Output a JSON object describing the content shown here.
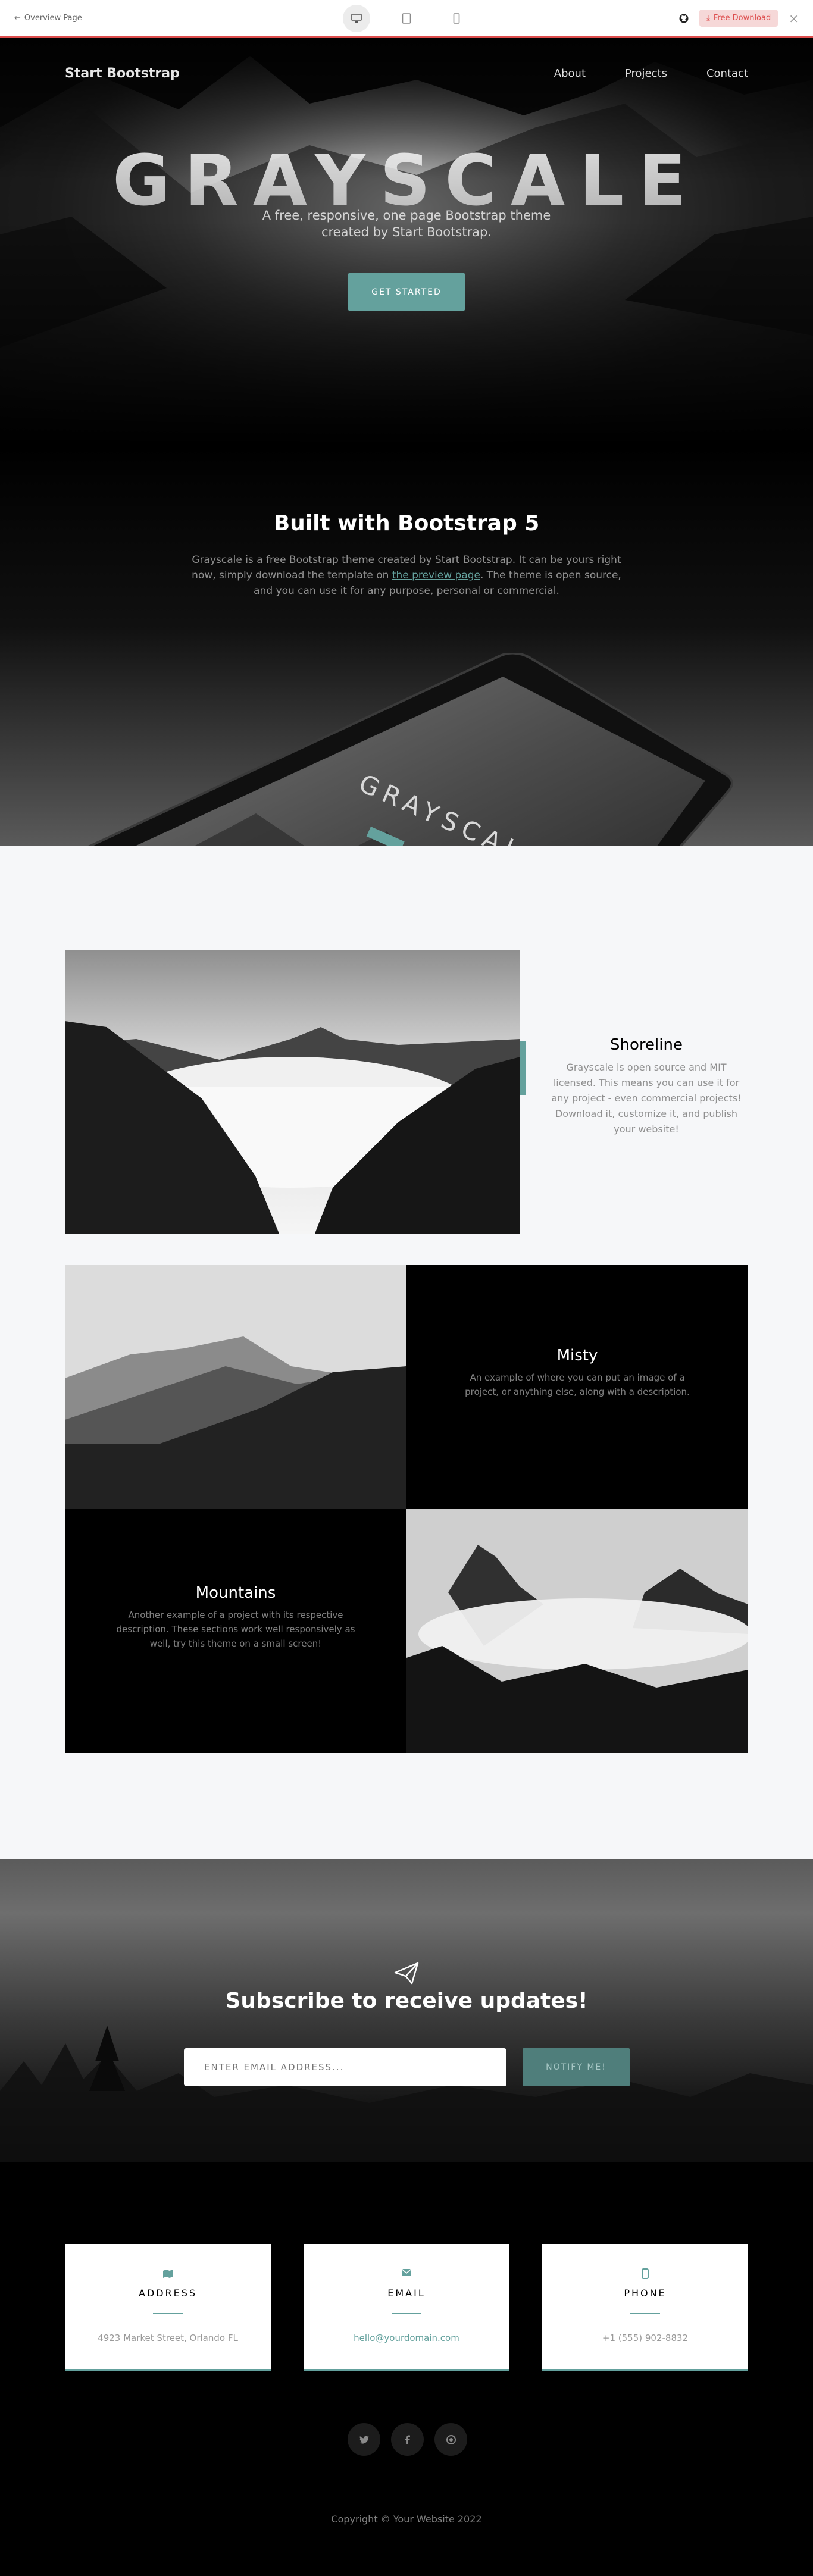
{
  "preview_bar": {
    "back_label": "Overview Page",
    "download_label": "Free Download",
    "devices": [
      "desktop-icon",
      "tablet-icon",
      "phone-icon"
    ]
  },
  "nav": {
    "brand": "Start Bootstrap",
    "links": [
      "About",
      "Projects",
      "Contact"
    ]
  },
  "hero": {
    "title": "GRAYSCALE",
    "subtitle": "A free, responsive, one page Bootstrap theme created by Start Bootstrap.",
    "button": "GET STARTED"
  },
  "about": {
    "title": "Built with Bootstrap 5",
    "text_before": "Grayscale is a free Bootstrap theme created by Start Bootstrap. It can be yours right now, simply download the template on ",
    "link_text": "the preview page",
    "text_after": ". The theme is open source, and you can use it for any purpose, personal or commercial.",
    "tablet_screen_title": "GRAYSCALE"
  },
  "projects": {
    "featured": {
      "title": "Shoreline",
      "text": "Grayscale is open source and MIT licensed. This means you can use it for any project - even commercial projects! Download it, customize it, and publish your website!"
    },
    "items": [
      {
        "title": "Misty",
        "text": "An example of where you can put an image of a project, or anything else, along with a description."
      },
      {
        "title": "Mountains",
        "text": "Another example of a project with its respective description. These sections work well responsively as well, try this theme on a small screen!"
      }
    ]
  },
  "signup": {
    "title": "Subscribe to receive updates!",
    "placeholder": "ENTER EMAIL ADDRESS...",
    "button": "NOTIFY ME!"
  },
  "contact": {
    "cards": [
      {
        "icon": "map-icon",
        "label": "ADDRESS",
        "value": "4923 Market Street, Orlando FL"
      },
      {
        "icon": "envelope-icon",
        "label": "EMAIL",
        "value": "hello@yourdomain.com"
      },
      {
        "icon": "mobile-icon",
        "label": "PHONE",
        "value": "+1 (555) 902-8832"
      }
    ],
    "socials": [
      "twitter-icon",
      "facebook-icon",
      "github-icon"
    ],
    "copyright": "Copyright © Your Website 2022"
  },
  "colors": {
    "primary": "#64a19d",
    "preview_accent": "#dd4d4d",
    "light_bg": "#f6f7f9"
  }
}
